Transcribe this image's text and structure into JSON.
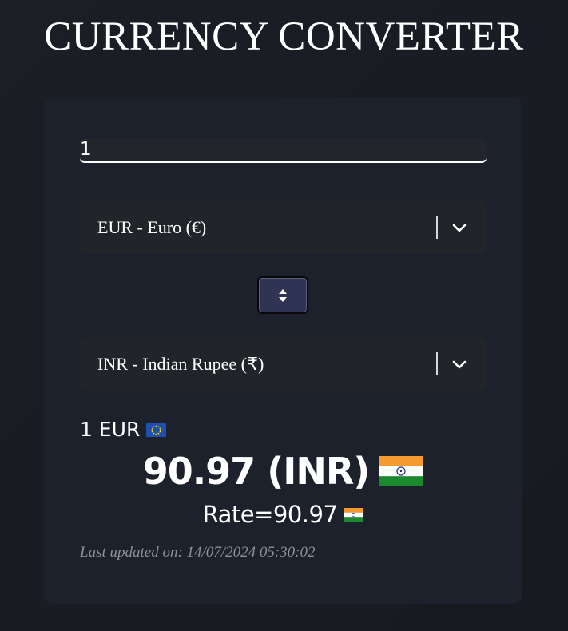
{
  "app": {
    "title": "CURRENCY CONVERTER"
  },
  "converter": {
    "amount": {
      "value": "1",
      "placeholder": ""
    },
    "from_currency": {
      "selected": "EUR - Euro (€)",
      "flag": "eu-flag-icon"
    },
    "to_currency": {
      "selected": "INR - Indian Rupee (₹)",
      "flag": "india-flag-icon"
    },
    "swap_button": {
      "icon": "swap-updown-icon"
    },
    "result": {
      "from_text": "1 EUR",
      "converted_text": "90.97 (INR)",
      "rate_text": "Rate=90.97",
      "last_updated": "Last updated on: 14/07/2024 05:30:02"
    }
  },
  "colors": {
    "background": "#191c22",
    "card": "#1c212b",
    "field": "#212429",
    "swap_button": "#2f3354",
    "muted_text": "#8e9096"
  }
}
